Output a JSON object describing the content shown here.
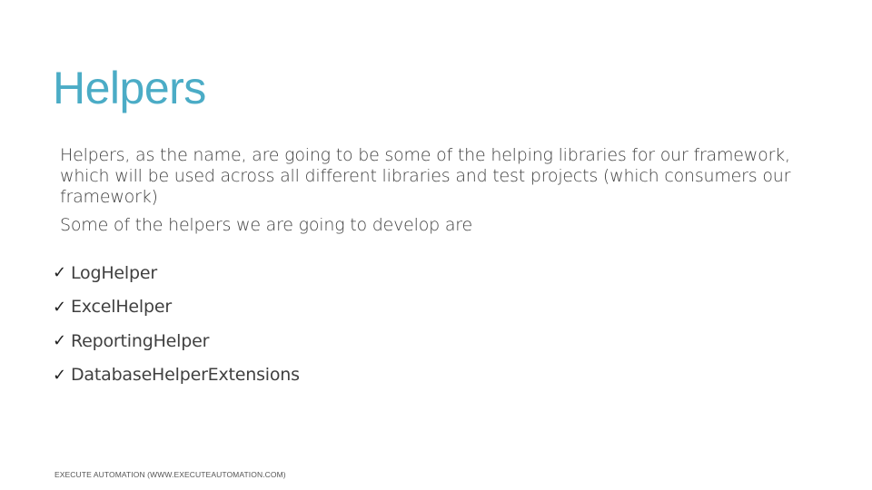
{
  "slide": {
    "title": "Helpers",
    "paragraph": "Helpers, as the name, are going to be some of the helping libraries for our framework, which will be used across all different libraries and test projects (which consumers our framework)",
    "intro": "Some of the helpers we are going to develop are",
    "checklist": [
      {
        "icon": "checkmark-icon",
        "mark": "✓",
        "label": "LogHelper"
      },
      {
        "icon": "checkmark-icon",
        "mark": "✓",
        "label": "ExcelHelper"
      },
      {
        "icon": "checkmark-icon",
        "mark": "✓",
        "label": "ReportingHelper"
      },
      {
        "icon": "checkmark-icon",
        "mark": "✓",
        "label": "DatabaseHelperExtensions"
      }
    ],
    "footer": "EXECUTE AUTOMATION (WWW.EXECUTEAUTOMATION.COM)"
  },
  "colors": {
    "title": "#4bacc6",
    "body_text": "#404040",
    "background": "#ffffff"
  }
}
